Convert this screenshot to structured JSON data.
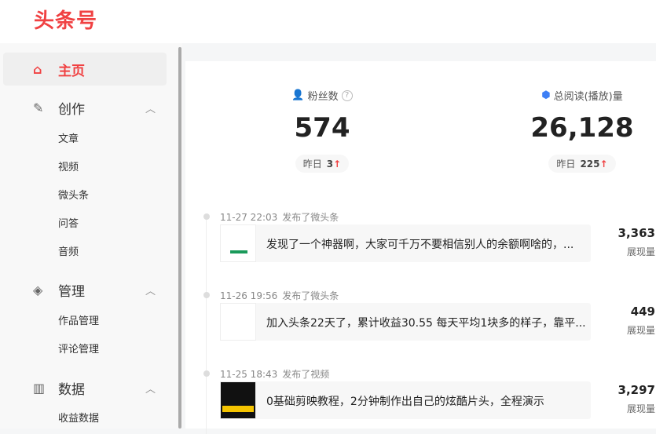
{
  "logo": "头条号",
  "sidebar": {
    "home": "主页",
    "create": "创作",
    "create_items": [
      "文章",
      "视频",
      "微头条",
      "问答",
      "音频"
    ],
    "manage": "管理",
    "manage_items": [
      "作品管理",
      "评论管理"
    ],
    "data": "数据",
    "data_items": [
      "收益数据"
    ]
  },
  "stats": [
    {
      "label": "粉丝数",
      "value": "574",
      "yesterday_label": "昨日",
      "yesterday": "3"
    },
    {
      "label": "总阅读(播放)量",
      "value": "26,128",
      "yesterday_label": "昨日",
      "yesterday": "225"
    }
  ],
  "feed": [
    {
      "time": "11-27 22:03",
      "action": "发布了微头条",
      "title": "发现了一个神器啊，大家可千万不要相信别人的余额啊啥的，...",
      "count": "3,363",
      "count_label": "展现量"
    },
    {
      "time": "11-26 19:56",
      "action": "发布了微头条",
      "title": "加入头条22天了，累计收益30.55 每天平均1块多的样子，靠平...",
      "count": "449",
      "count_label": "展现量"
    },
    {
      "time": "11-25 18:43",
      "action": "发布了视频",
      "title": "0基础剪映教程，2分钟制作出自己的炫酷片头，全程演示",
      "count": "3,297",
      "count_label": "展现量"
    }
  ]
}
